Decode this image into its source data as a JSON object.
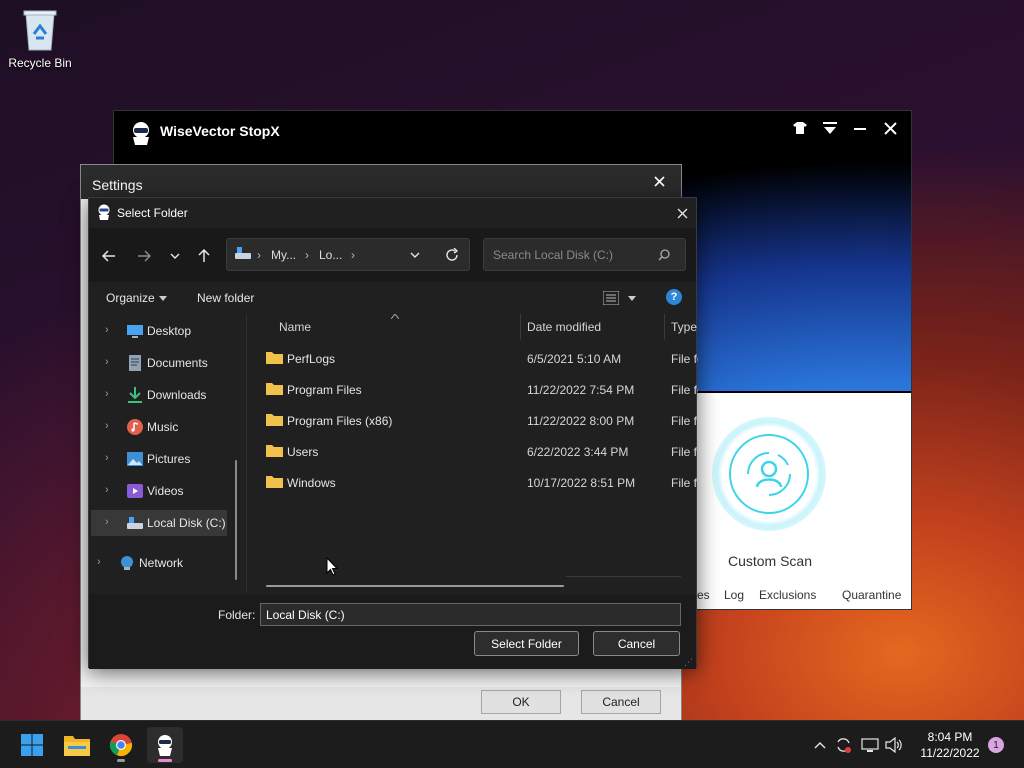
{
  "desktop": {
    "recycle_bin_label": "Recycle Bin"
  },
  "wisevector": {
    "title": "WiseVector StopX",
    "custom_scan_label": "Custom Scan",
    "nav": [
      "es",
      "Log",
      "Exclusions",
      "Quarantine"
    ]
  },
  "settings": {
    "title": "Settings",
    "ok_label": "OK",
    "cancel_label": "Cancel"
  },
  "dialog": {
    "title": "Select Folder",
    "breadcrumb": [
      "My...",
      "Lo..."
    ],
    "search_placeholder": "Search Local Disk (C:)",
    "toolbar": {
      "organize": "Organize",
      "new_folder": "New folder"
    },
    "tree": [
      {
        "label": "Desktop",
        "icon": "desktop-icon"
      },
      {
        "label": "Documents",
        "icon": "documents-icon"
      },
      {
        "label": "Downloads",
        "icon": "downloads-icon"
      },
      {
        "label": "Music",
        "icon": "music-icon"
      },
      {
        "label": "Pictures",
        "icon": "pictures-icon"
      },
      {
        "label": "Videos",
        "icon": "videos-icon"
      },
      {
        "label": "Local Disk (C:)",
        "icon": "drive-icon",
        "selected": true
      },
      {
        "label": "Network",
        "icon": "network-icon"
      }
    ],
    "columns": {
      "name": "Name",
      "date_modified": "Date modified",
      "type": "Type"
    },
    "files": [
      {
        "name": "PerfLogs",
        "date": "6/5/2021 5:10 AM",
        "type": "File folder"
      },
      {
        "name": "Program Files",
        "date": "11/22/2022 7:54 PM",
        "type": "File folder"
      },
      {
        "name": "Program Files (x86)",
        "date": "11/22/2022 8:00 PM",
        "type": "File folder"
      },
      {
        "name": "Users",
        "date": "6/22/2022 3:44 PM",
        "type": "File folder"
      },
      {
        "name": "Windows",
        "date": "10/17/2022 8:51 PM",
        "type": "File folder"
      }
    ],
    "folder_label": "Folder:",
    "folder_value": "Local Disk (C:)",
    "select_button": "Select Folder",
    "cancel_button": "Cancel"
  },
  "taskbar": {
    "apps": [
      "start-icon",
      "file-explorer-icon",
      "chrome-icon",
      "wisevector-icon"
    ],
    "time": "8:04 PM",
    "date": "11/22/2022",
    "notification_count": "1"
  },
  "colors": {
    "accent": "#2f86d6",
    "folder": "#f0c14b",
    "scan_ring": "#3bd4e8",
    "active_task": "#e98bd6"
  }
}
